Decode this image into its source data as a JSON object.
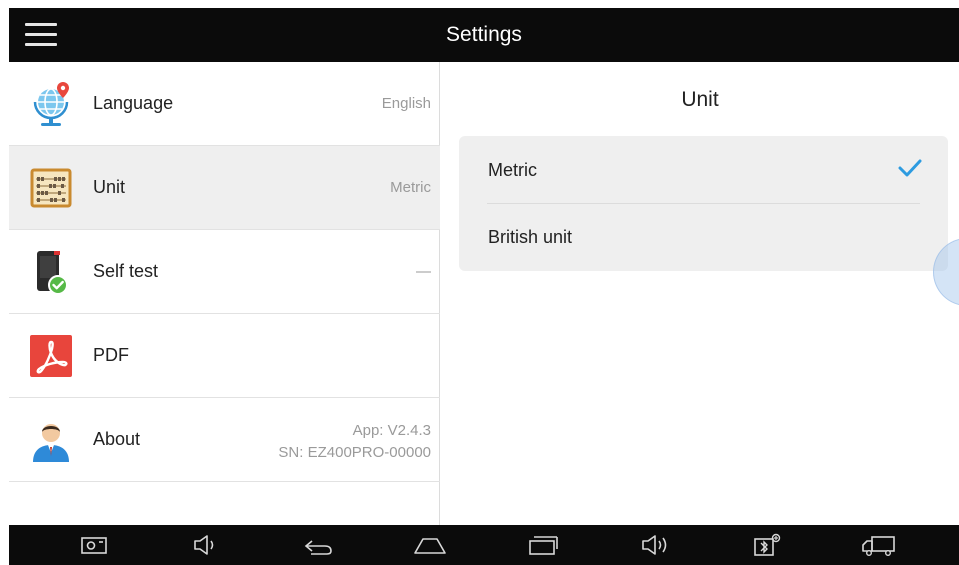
{
  "header": {
    "title": "Settings"
  },
  "sidebar": {
    "items": [
      {
        "label": "Language",
        "value": "English",
        "icon": "globe-icon"
      },
      {
        "label": "Unit",
        "value": "Metric",
        "icon": "abacus-icon",
        "active": true
      },
      {
        "label": "Self test",
        "value": "—",
        "icon": "device-check-icon"
      },
      {
        "label": "PDF",
        "value": "",
        "icon": "pdf-icon"
      },
      {
        "label": "About",
        "value_lines": [
          "App: V2.4.3",
          "SN: EZ400PRO-00000"
        ],
        "icon": "user-icon"
      }
    ]
  },
  "main": {
    "title": "Unit",
    "options": [
      {
        "label": "Metric",
        "selected": true
      },
      {
        "label": "British unit",
        "selected": false
      }
    ],
    "accent_color": "#2d9be0"
  },
  "navbar": {
    "buttons": [
      "screenshot-icon",
      "volume-down-icon",
      "back-icon",
      "home-icon",
      "recent-apps-icon",
      "volume-up-icon",
      "bluetooth-vci-icon",
      "truck-icon"
    ]
  }
}
